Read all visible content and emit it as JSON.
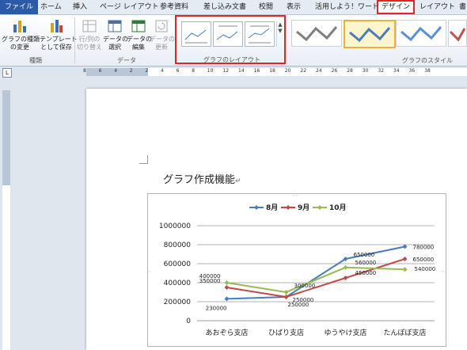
{
  "tabs": [
    "ファイル",
    "ホーム",
    "挿入",
    "ページ レイアウト",
    "参考資料",
    "差し込み文書",
    "校閲",
    "表示",
    "活用しよう！ワード",
    "デザイン",
    "レイアウト",
    "書"
  ],
  "ribbon": {
    "buttons": {
      "change_type": "グラフの種類\nの変更",
      "save_template": "テンプレート\nとして保存",
      "switch_rowcol": "行/列の\n切り替え",
      "select_data": "データの\n選択",
      "edit_data": "データの\n編集",
      "refresh_data": "データの\n更新"
    },
    "groups": {
      "type": "種類",
      "data": "データ",
      "layout": "グラフのレイアウト",
      "style": "グラフのスタイル"
    }
  },
  "ruler": {
    "h_ticks": [
      "8",
      "6",
      "4",
      "2",
      "2",
      "4",
      "6",
      "8",
      "10",
      "12",
      "14",
      "16",
      "18",
      "20",
      "22",
      "24",
      "26",
      "28",
      "30",
      "32",
      "34",
      "36",
      "38"
    ],
    "corner": "L"
  },
  "document": {
    "title": "グラフ作成機能"
  },
  "colors": {
    "accent_red": "#e0252a",
    "s8": "#4a7ebb",
    "s9": "#be4b48",
    "s10": "#98b954"
  },
  "chart_data": {
    "type": "line",
    "categories": [
      "あおぞら支店",
      "ひばり支店",
      "ゆうやけ支店",
      "たんぽぽ支店"
    ],
    "series": [
      {
        "name": "8月",
        "values": [
          230000,
          250000,
          650000,
          780000
        ]
      },
      {
        "name": "9月",
        "values": [
          350000,
          250000,
          450000,
          650000
        ]
      },
      {
        "name": "10月",
        "values": [
          400000,
          300000,
          560000,
          540000
        ]
      }
    ],
    "y_ticks": [
      "0",
      "200000",
      "400000",
      "600000",
      "800000",
      "1000000"
    ],
    "ylim": [
      0,
      1000000
    ],
    "grid": true,
    "legend": "top"
  }
}
